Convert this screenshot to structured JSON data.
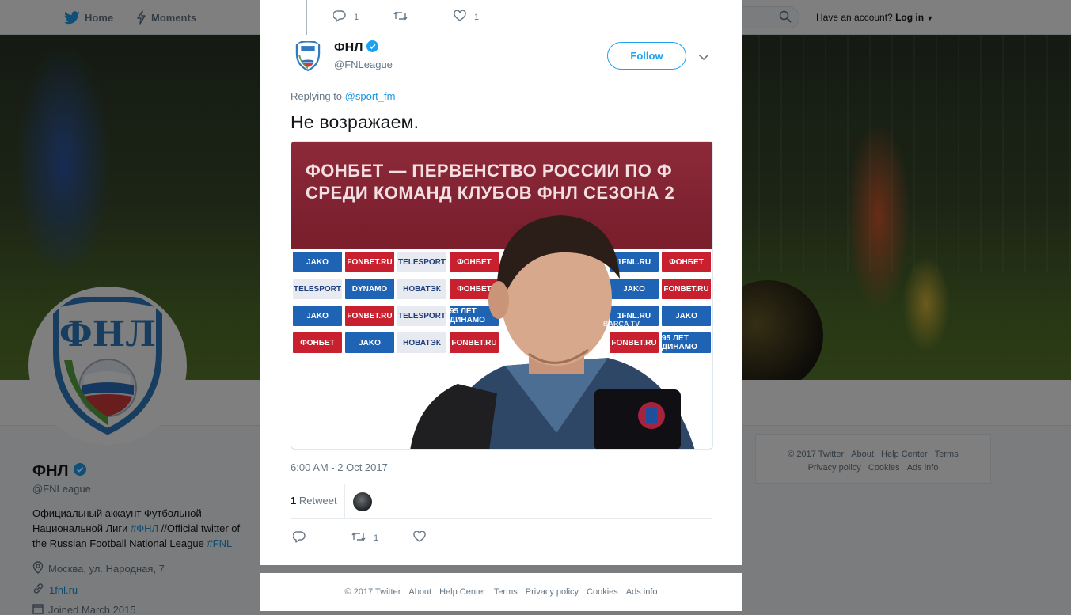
{
  "nav": {
    "home": "Home",
    "moments": "Moments",
    "account_prompt": "Have an account?",
    "login": "Log in"
  },
  "profile": {
    "name": "ФНЛ",
    "handle": "@FNLeague",
    "bio_part1": "Официальный аккаунт Футбольной Национальной Лиги ",
    "bio_tag1": "#ФНЛ",
    "bio_part2": " //Official twitter of the Russian Football National League ",
    "bio_tag2": "#FNL",
    "location": "Москва, ул. Народная, 7",
    "website": "1fnl.ru",
    "joined": "Joined March 2015",
    "avatar_text": "ФНЛ"
  },
  "side_footer": {
    "row1": [
      "© 2017 Twitter",
      "About",
      "Help Center",
      "Terms"
    ],
    "row2": [
      "Privacy policy",
      "Cookies",
      "Ads info"
    ]
  },
  "parent_tweet": {
    "reply_count": "1",
    "retweet_count": "",
    "like_count": "1"
  },
  "tweet": {
    "author_name": "ФНЛ",
    "author_handle": "@FNLeague",
    "follow_label": "Follow",
    "replying_prefix": "Replying to",
    "replying_to": "@sport_fm",
    "text": "Не возражаем.",
    "timestamp": "6:00 AM - 2 Oct 2017",
    "retweets": {
      "count": "1",
      "label": "Retweet"
    },
    "actions": {
      "reply_count": "",
      "retweet_count": "1",
      "like_count": ""
    }
  },
  "media": {
    "banner_line1": "ФОНБЕТ — ПЕРВЕНСТВО РОССИИ ПО Ф",
    "banner_line2": "СРЕДИ КОМАНД КЛУБОВ ФНЛ СЕЗОНА 2",
    "wall_logos": [
      {
        "text": "JAKO",
        "color": "#1f63b5"
      },
      {
        "text": "FONBET.RU",
        "color": "#c8202f"
      },
      {
        "text": "TELESPORT",
        "color": "#e7eaf0"
      },
      {
        "text": "ФОНБЕТ",
        "color": "#c8202f"
      },
      {
        "text": "TELESPORT",
        "color": "#e7eaf0"
      },
      {
        "text": "DYNAMO",
        "color": "#1f63b5"
      },
      {
        "text": "НОВАТЭК",
        "color": "#e7eaf0"
      },
      {
        "text": "ФОНБЕТ",
        "color": "#c8202f"
      },
      {
        "text": "JAKO",
        "color": "#1f63b5"
      },
      {
        "text": "FONBET.RU",
        "color": "#c8202f"
      },
      {
        "text": "TELESPORT",
        "color": "#e7eaf0"
      },
      {
        "text": "95 ЛЕТ ДИНАМО",
        "color": "#1f63b5"
      },
      {
        "text": "ФОНБЕТ",
        "color": "#c8202f"
      },
      {
        "text": "JAKO",
        "color": "#1f63b5"
      },
      {
        "text": "НОВАТЭК",
        "color": "#e7eaf0"
      },
      {
        "text": "FONBET.RU",
        "color": "#c8202f"
      }
    ],
    "right_logos": [
      {
        "text": "1FNL.RU",
        "color": "#1f63b5"
      },
      {
        "text": "ФОНБЕТ",
        "color": "#c8202f"
      },
      {
        "text": "JAKO",
        "color": "#1f63b5"
      },
      {
        "text": "FONBET.RU",
        "color": "#c8202f"
      },
      {
        "text": "1FNL.RU",
        "color": "#1f63b5"
      },
      {
        "text": "JAKO",
        "color": "#1f63b5"
      },
      {
        "text": "FONBET.RU",
        "color": "#c8202f"
      },
      {
        "text": "95 ЛЕТ ДИНАМО",
        "color": "#1f63b5"
      }
    ],
    "mic_text": "BARÇA TV"
  },
  "bottom_footer": [
    "© 2017 Twitter",
    "About",
    "Help Center",
    "Terms",
    "Privacy policy",
    "Cookies",
    "Ads info"
  ],
  "colors": {
    "accent": "#1da1f2",
    "link": "#1b95e0",
    "muted": "#657786"
  }
}
